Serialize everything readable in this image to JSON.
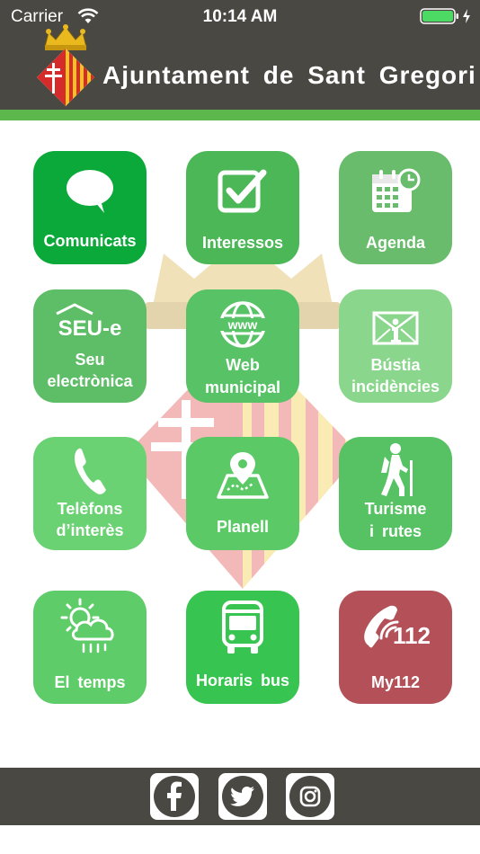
{
  "status_bar": {
    "carrier": "Carrier",
    "time": "10:14 AM"
  },
  "header": {
    "title": "Ajuntament de Sant Gregori"
  },
  "colors": {
    "header_bg": "#4a4843",
    "accent_green": "#5cb84c",
    "emergency_red": "#b45158"
  },
  "tiles": [
    {
      "label": "Comunicats",
      "icon": "speech-bubble-icon"
    },
    {
      "label": "Interessos",
      "icon": "checkbox-icon"
    },
    {
      "label": "Agenda",
      "icon": "calendar-clock-icon"
    },
    {
      "line1": "Seu",
      "line2": "electrònica",
      "icon": "seu-e-icon",
      "icon_text": "SEU-e"
    },
    {
      "line1": "Web",
      "line2": "municipal",
      "icon": "globe-www-icon",
      "icon_text": "www"
    },
    {
      "line1": "Bústia",
      "line2": "incidències",
      "icon": "mail-info-icon"
    },
    {
      "line1": "Telèfons",
      "line2": "d’interès",
      "icon": "phone-icon"
    },
    {
      "label": "Planell",
      "icon": "map-pin-icon"
    },
    {
      "line1": "Turisme",
      "line2": "i rutes",
      "icon": "hiker-icon"
    },
    {
      "label": "El temps",
      "icon": "weather-icon"
    },
    {
      "label": "Horaris bus",
      "icon": "bus-icon"
    },
    {
      "label": "My112",
      "icon": "emergency-phone-icon",
      "icon_text": "112"
    }
  ],
  "footer": {
    "icons": [
      "facebook-icon",
      "twitter-icon",
      "instagram-icon"
    ]
  }
}
